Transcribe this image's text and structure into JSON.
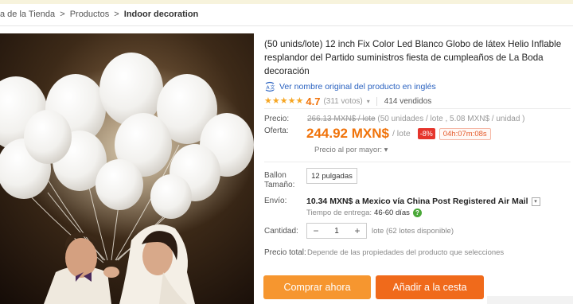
{
  "breadcrumb": {
    "items": [
      "a de la Tienda",
      "Productos",
      "Indoor decoration"
    ],
    "separator": ">"
  },
  "product": {
    "image_icon": "white-balloons-couple-photo",
    "title": "(50 unids/lote) 12 inch Fix Color Led Blanco Globo de látex Helio Inflable resplandor del Partido suministros fiesta de cumpleaños de La Boda decoración",
    "original_name_link": "Ver nombre original del producto en inglés",
    "translate_icon": "translate-icon",
    "rating": {
      "value": "4.7",
      "stars": 5,
      "votes": "(311 votos)",
      "caret": "▾"
    },
    "sold": "414 vendidos"
  },
  "price": {
    "label": "Precio:",
    "old_value": "266.13 MXN$ / lote",
    "old_detail": "(50 unidades / lote , 5.08 MXN$ / unidad )",
    "offer_label": "Oferta:",
    "offer_value": "244.92 MXN$",
    "offer_unit": "/ lote",
    "discount": "-8%",
    "timer": "04h:07m:08s",
    "wholesale": "Precio al por mayor: ▾"
  },
  "option": {
    "label_line1": "Ballon",
    "label_line2": "Tamaño:",
    "selected": "12 pulgadas"
  },
  "shipping": {
    "label": "Envío:",
    "value": "10.34 MXN$ a Mexico vía China Post Registered Air Mail",
    "dropdown": "▾",
    "time_label": "Tiempo de entrega:",
    "time_value": "46-60 días",
    "help": "?"
  },
  "quantity": {
    "label": "Cantidad:",
    "minus": "−",
    "value": "1",
    "plus": "+",
    "note": "lote (62 lotes disponible)"
  },
  "total": {
    "label": "Precio total:",
    "note": "Depende de las propiedades del producto que selecciones"
  },
  "actions": {
    "buy_now": "Comprar ahora",
    "add_to_cart": "Añadir a la cesta"
  },
  "colors": {
    "accent_orange": "#f0730a",
    "buy_now_bg": "#f6962f",
    "add_cart_bg": "#f06a1b",
    "discount_bg": "#e5352c",
    "link_blue": "#2a62c0",
    "star": "#f6a623"
  }
}
